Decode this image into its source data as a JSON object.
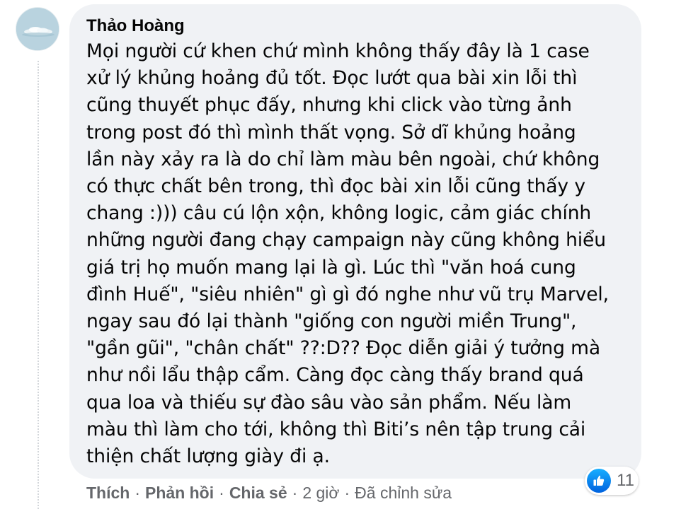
{
  "comment": {
    "author": "Thảo Hoàng",
    "lines": [
      "Mọi người cứ khen chứ mình không thấy đây là 1 case",
      "xử lý khủng hoảng đủ tốt. Đọc lướt qua bài xin lỗi thì",
      "cũng thuyết phục đấy, nhưng khi click vào từng ảnh",
      "trong post đó thì mình thất vọng. Sở dĩ khủng hoảng",
      "lần này xảy ra là do chỉ làm màu bên ngoài, chứ không",
      "có thực chất bên trong, thì đọc bài xin lỗi cũng thấy y",
      "chang :))) câu cú lộn xộn, không logic, cảm giác chính",
      "những người đang chạy campaign này cũng không hiểu",
      "giá trị họ muốn mang lại là gì. Lúc thì \"văn hoá cung",
      "đình Huế\", \"siêu nhiên\" gì gì đó nghe như vũ trụ Marvel,",
      "ngay sau đó lại thành \"giống con người miền Trung\",",
      "\"gần gũi\", \"chân chất\" ??:D?? Đọc diễn giải ý tưởng mà",
      "như nồi lẩu thập cẩm. Càng đọc càng thấy brand quá",
      "qua loa và thiếu sự đào sâu vào sản phẩm. Nếu làm",
      "màu thì làm cho tới, không thì Biti’s nên tập trung cải",
      "thiện chất lượng giày đi ạ."
    ],
    "reaction": {
      "icon": "like-icon",
      "count": "11",
      "color": "#1877f2"
    }
  },
  "actions": {
    "like_label": "Thích",
    "reply_label": "Phản hồi",
    "share_label": "Chia sẻ",
    "separator": "·",
    "time": "2 giờ",
    "edited": "Đã chỉnh sửa"
  },
  "colors": {
    "bubble_bg": "#f0f2f5",
    "text": "#050505",
    "secondary_text": "#65676b"
  }
}
